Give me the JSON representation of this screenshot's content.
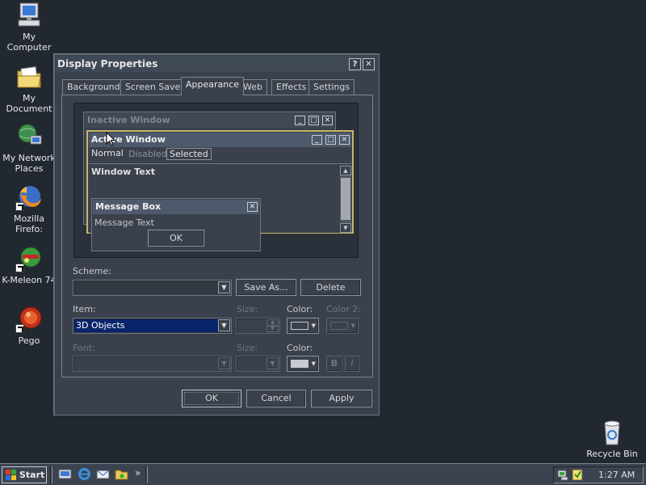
{
  "desktop": {
    "icons": [
      {
        "label": "My Computer"
      },
      {
        "label": "My Document"
      },
      {
        "label": "My Network Places"
      },
      {
        "label": "Mozilla Firefo:"
      },
      {
        "label": "K-Meleon 74"
      },
      {
        "label": "Pego"
      },
      {
        "label": "Recycle Bin"
      }
    ]
  },
  "dialog": {
    "title": "Display Properties",
    "help_glyph": "?",
    "close_glyph": "✕",
    "tabs": [
      "Background",
      "Screen Saver",
      "Appearance",
      "Web",
      "Effects",
      "Settings"
    ],
    "active_tab": "Appearance",
    "preview": {
      "inactive_title": "Inactive Window",
      "active_title": "Active Window",
      "menu_normal": "Normal",
      "menu_disabled": "Disabled",
      "menu_selected": "Selected",
      "window_text": "Window Text",
      "message_box_title": "Message Box",
      "message_text": "Message Text",
      "ok": "OK"
    },
    "scheme": {
      "label": "Scheme:",
      "value": "",
      "save_as": "Save As...",
      "delete": "Delete"
    },
    "item": {
      "label": "Item:",
      "value": "3D Objects",
      "size_label": "Size:",
      "color_label": "Color:",
      "color2_label": "Color 2:"
    },
    "font": {
      "label": "Font:",
      "size_label": "Size:",
      "color_label": "Color:",
      "bold": "B",
      "italic": "I"
    },
    "buttons": {
      "ok": "OK",
      "cancel": "Cancel",
      "apply": "Apply"
    }
  },
  "taskbar": {
    "start": "Start",
    "more": "»",
    "clock": "1:27 AM"
  },
  "colors": {
    "desktop": "#222830",
    "window": "#3a414c",
    "selection": "#0a246a",
    "active_frame": "#c7b56a"
  }
}
